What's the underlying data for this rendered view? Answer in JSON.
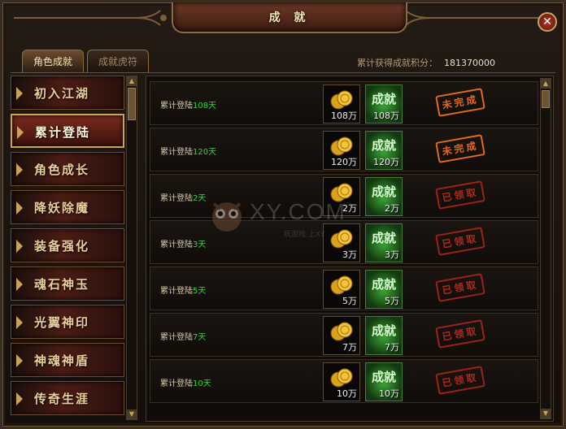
{
  "window": {
    "title": "成 就",
    "close_glyph": "✕"
  },
  "tabs": [
    {
      "label": "角色成就",
      "active": true
    },
    {
      "label": "成就虎符",
      "active": false
    }
  ],
  "score": {
    "label": "累计获得成就积分：",
    "value": "181370000"
  },
  "categories": [
    {
      "label": "初入江湖",
      "active": false
    },
    {
      "label": "累计登陆",
      "active": true
    },
    {
      "label": "角色成长",
      "active": false
    },
    {
      "label": "降妖除魔",
      "active": false
    },
    {
      "label": "装备强化",
      "active": false
    },
    {
      "label": "魂石神玉",
      "active": false
    },
    {
      "label": "光翼神印",
      "active": false
    },
    {
      "label": "神魂神盾",
      "active": false
    },
    {
      "label": "传奇生涯",
      "active": false
    }
  ],
  "achievements": [
    {
      "prefix": "累计登陆",
      "days": "108天",
      "coin_qty": "108万",
      "ach_label": "成就",
      "ach_qty": "108万",
      "status": "未完成",
      "status_kind": "todo"
    },
    {
      "prefix": "累计登陆",
      "days": "120天",
      "coin_qty": "120万",
      "ach_label": "成就",
      "ach_qty": "120万",
      "status": "未完成",
      "status_kind": "todo"
    },
    {
      "prefix": "累计登陆",
      "days": "2天",
      "coin_qty": "2万",
      "ach_label": "成就",
      "ach_qty": "2万",
      "status": "已领取",
      "status_kind": "claimed"
    },
    {
      "prefix": "累计登陆",
      "days": "3天",
      "coin_qty": "3万",
      "ach_label": "成就",
      "ach_qty": "3万",
      "status": "已领取",
      "status_kind": "claimed"
    },
    {
      "prefix": "累计登陆",
      "days": "5天",
      "coin_qty": "5万",
      "ach_label": "成就",
      "ach_qty": "5万",
      "status": "已领取",
      "status_kind": "claimed"
    },
    {
      "prefix": "累计登陆",
      "days": "7天",
      "coin_qty": "7万",
      "ach_label": "成就",
      "ach_qty": "7万",
      "status": "已领取",
      "status_kind": "claimed"
    },
    {
      "prefix": "累计登陆",
      "days": "10天",
      "coin_qty": "10万",
      "ach_label": "成就",
      "ach_qty": "10万",
      "status": "已领取",
      "status_kind": "claimed"
    }
  ],
  "watermark": {
    "text": "XY.COM",
    "sub": "玩游戏 上XY"
  },
  "colors": {
    "gold": "#c9a35a",
    "days_green": "#3cd23c",
    "stamp_red": "#c4301f",
    "stamp_orange": "#e06a1c"
  }
}
